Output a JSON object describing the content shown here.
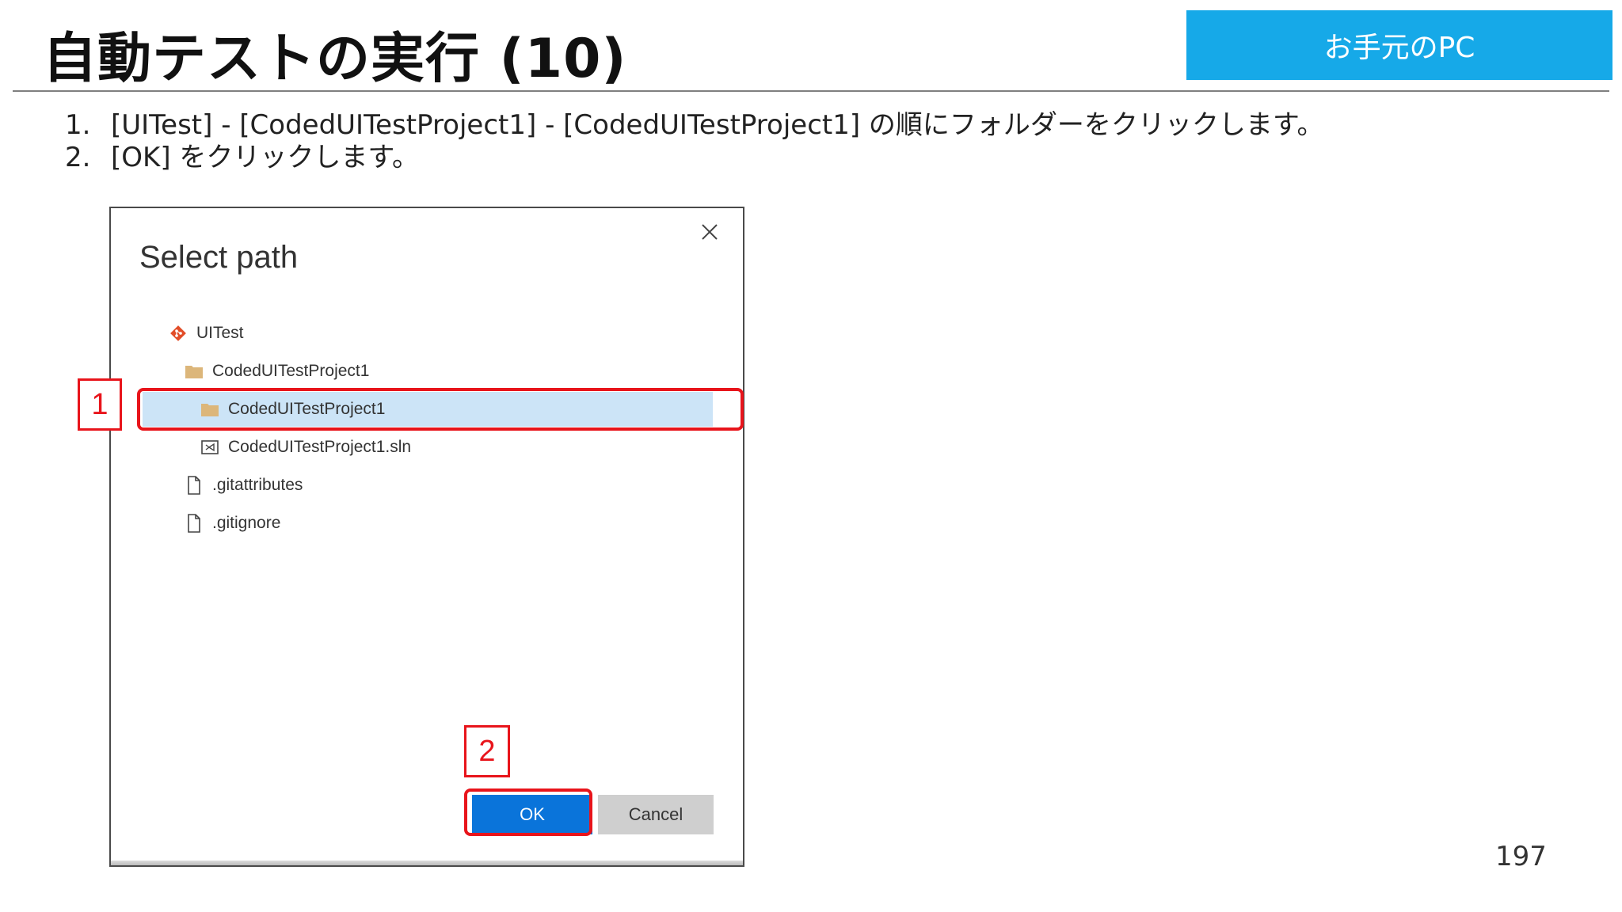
{
  "slide": {
    "title": "自動テストの実行 (10)",
    "environment_badge": "お手元のPC",
    "page_number": "197"
  },
  "steps": [
    {
      "number": "1.",
      "text": "[UITest] - [CodedUITestProject1] - [CodedUITestProject1] の順にフォルダーをクリックします。"
    },
    {
      "number": "2.",
      "text": "[OK] をクリックします。"
    }
  ],
  "dialog": {
    "title": "Select path",
    "close_icon": "close-icon",
    "tree": [
      {
        "label": "UITest",
        "icon": "git-repo-icon",
        "level": 0,
        "selected": false
      },
      {
        "label": "CodedUITestProject1",
        "icon": "folder-icon",
        "level": 1,
        "selected": false
      },
      {
        "label": "CodedUITestProject1",
        "icon": "folder-icon",
        "level": 2,
        "selected": true
      },
      {
        "label": "CodedUITestProject1.sln",
        "icon": "solution-file-icon",
        "level": 2,
        "selected": false
      },
      {
        "label": ".gitattributes",
        "icon": "file-icon",
        "level": 1,
        "selected": false
      },
      {
        "label": ".gitignore",
        "icon": "file-icon",
        "level": 1,
        "selected": false
      }
    ],
    "ok_label": "OK",
    "cancel_label": "Cancel"
  },
  "callouts": [
    {
      "label": "1",
      "target": "selected-folder"
    },
    {
      "label": "2",
      "target": "ok-button"
    }
  ],
  "colors": {
    "badge": "#16a9e8",
    "callout": "#e8141b",
    "ok_button": "#0a74da",
    "selection": "#cce4f7"
  }
}
